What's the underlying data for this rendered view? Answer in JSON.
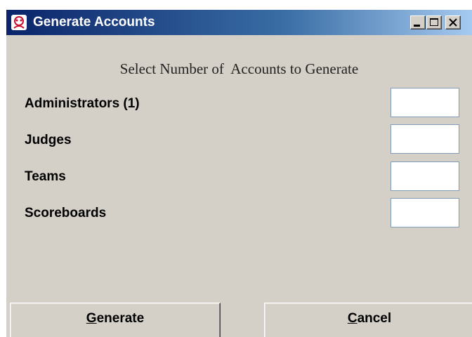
{
  "window": {
    "title": "Generate Accounts",
    "icon": "app-logo-icon"
  },
  "dialog": {
    "heading": "Select Number of  Accounts to Generate",
    "rows": [
      {
        "label": "Administrators (1)",
        "value": ""
      },
      {
        "label": "Judges",
        "value": ""
      },
      {
        "label": "Teams",
        "value": ""
      },
      {
        "label": "Scoreboards",
        "value": ""
      }
    ]
  },
  "buttons": {
    "generate": {
      "mnemonic": "G",
      "rest": "enerate"
    },
    "cancel": {
      "mnemonic": "C",
      "rest": "ancel"
    }
  },
  "colors": {
    "titlebar_start": "#0a246a",
    "titlebar_end": "#a6caf0",
    "window_bg": "#d4d0c8"
  }
}
